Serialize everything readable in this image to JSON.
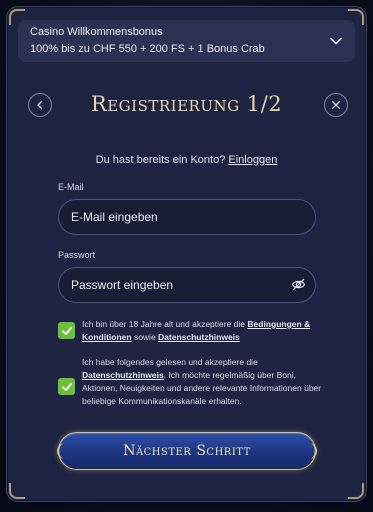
{
  "bonus": {
    "title": "Casino Willkommensbonus",
    "detail": "100% bis zu CHF 550 + 200 FS + 1 Bonus Crab"
  },
  "header": {
    "title": "Registrierung 1/2",
    "back_icon": "chevron-left-icon",
    "close_icon": "close-icon"
  },
  "login": {
    "prompt": "Du hast bereits ein Konto?",
    "link": "Einloggen"
  },
  "form": {
    "email_label": "E-Mail",
    "email_placeholder": "E-Mail eingeben",
    "password_label": "Passwort",
    "password_placeholder": "Passwort eingeben"
  },
  "consents": [
    {
      "checked": true,
      "text_before": "Ich bin über 18 Jahre alt und akzeptiere die ",
      "link1": "Bedingungen & Konditionen",
      "text_mid": " sowie ",
      "link2": "Datenschutzhinweis"
    },
    {
      "checked": true,
      "text_before": "Ich habe folgendes gelesen und akzeptiere die ",
      "link1": "Datenschutzhinweis",
      "text_after": ". Ich möchte regelmäßig über Boni, Aktionen, Neuigkeiten und andere relevante Informationen über beliebige Kommunikationskanäle erhalten."
    }
  ],
  "cta": {
    "label": "Nächster Schritt"
  },
  "colors": {
    "accent_gold": "#ead9ac",
    "checkbox_green": "#6bbf3a",
    "modal_bg": "#1d2340"
  }
}
